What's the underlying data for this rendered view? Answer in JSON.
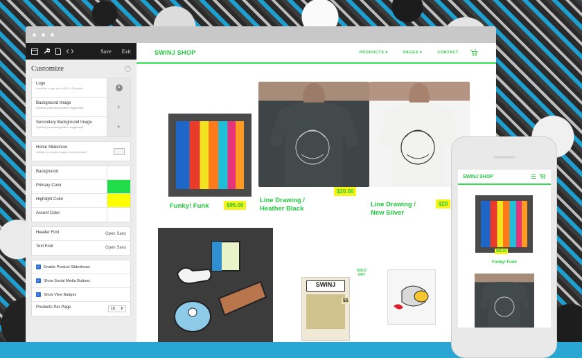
{
  "sidebar": {
    "toolbar": {
      "save": "Save",
      "exit": "Exit"
    },
    "title": "Customize",
    "help": "?",
    "images": [
      {
        "label": "Logo",
        "hint": "Good for a logo up to 600 x 130 pixels",
        "action": "×"
      },
      {
        "label": "Background Image",
        "hint": "Optional (repeating pattern suggested)",
        "action": "+"
      },
      {
        "label": "Secondary Background Image",
        "hint": "Optional (repeating pattern suggested)",
        "action": "+"
      }
    ],
    "slideshow": {
      "label": "Home Slideshow",
      "hint": "1400px by Xsteps images recommended"
    },
    "colors": [
      {
        "label": "Background",
        "color": "#ffffff"
      },
      {
        "label": "Primary Color",
        "color": "#22dd4a"
      },
      {
        "label": "Highlight Color",
        "color": "#ffff00"
      },
      {
        "label": "Accent Color",
        "color": "#ffffff"
      }
    ],
    "fonts": [
      {
        "label": "Header Font",
        "value": "Open Sans"
      },
      {
        "label": "Text Font",
        "value": "Open Sans"
      }
    ],
    "options": [
      {
        "label": "Enable Product Slideshows",
        "checked": true
      },
      {
        "label": "Show Social Media Buttons",
        "checked": true
      },
      {
        "label": "Show View Badges",
        "checked": true
      }
    ],
    "per_page": {
      "label": "Products Per Page",
      "value": "15"
    }
  },
  "site": {
    "logo": "SWINJ SHOP",
    "nav": [
      "PRODUCTS ▾",
      "PAGES ▾",
      "CONTACT"
    ],
    "cart_count": "0",
    "products": [
      {
        "title": "Funky! Funk",
        "price": "$95.00"
      },
      {
        "title": "Line Drawing / Heather Black",
        "price": "$20.00"
      },
      {
        "title": "Line Drawing / New Silver",
        "price": "$20"
      }
    ],
    "sold_out": "SOLD OUT",
    "sticker_text": "SWINJ",
    "sticker_price": "$5"
  },
  "mobile": {
    "logo": "SWINJ SHOP",
    "product_title": "Funky! Funk",
    "product_price": "$95.00"
  }
}
